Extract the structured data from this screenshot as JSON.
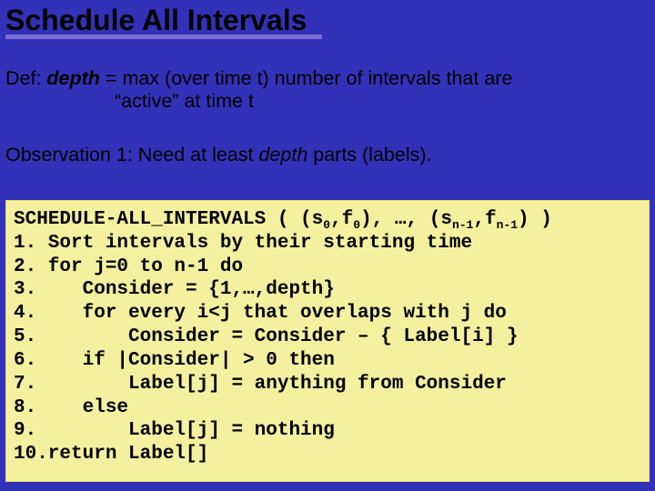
{
  "title": "Schedule All Intervals",
  "def": {
    "prefix": "Def: ",
    "term": "depth",
    "eq": "  = max (over time t) number of intervals that are",
    "line2": "“active” at time t"
  },
  "obs": {
    "prefix": "Observation 1: Need at least ",
    "term": "depth",
    "suffix": " parts (labels)."
  },
  "code": {
    "head_a": "SCHEDULE-ALL_INTERVALS ( (s",
    "head_b": ",f",
    "head_c": "), …, (s",
    "head_d": ",f",
    "head_e": ") )",
    "sub0": "0",
    "subn1": "n-1",
    "l1": "1. Sort intervals by their starting time",
    "l2": "2. for j=0 to n-1 do",
    "l3": "3.    Consider = {1,…,depth}",
    "l4": "4.    for every i<j that overlaps with j do",
    "l5": "5.        Consider = Consider – { Label[i] }",
    "l6": "6.    if |Consider| > 0 then",
    "l7": "7.        Label[j] = anything from Consider",
    "l8": "8.    else",
    "l9": "9.        Label[j] = nothing",
    "l10": "10.return Label[]"
  }
}
